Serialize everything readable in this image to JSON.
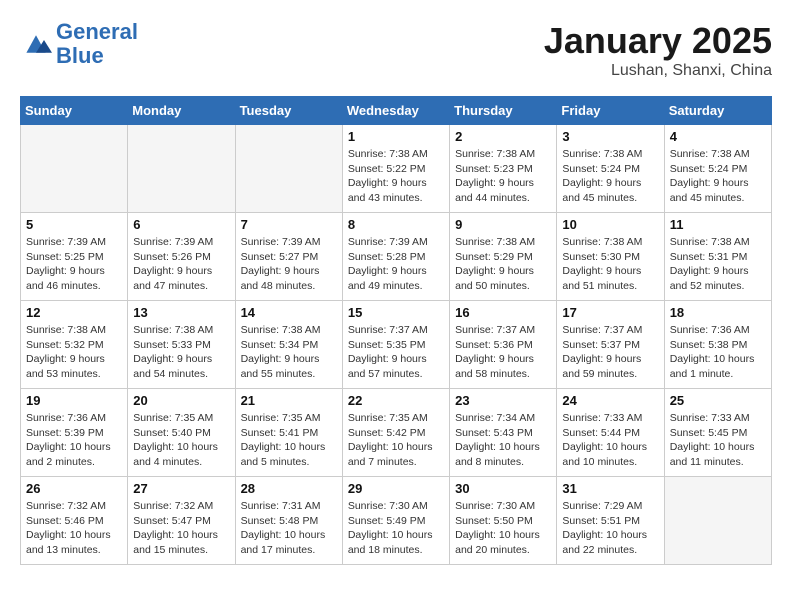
{
  "header": {
    "logo_general": "General",
    "logo_blue": "Blue",
    "month_title": "January 2025",
    "subtitle": "Lushan, Shanxi, China"
  },
  "days_of_week": [
    "Sunday",
    "Monday",
    "Tuesday",
    "Wednesday",
    "Thursday",
    "Friday",
    "Saturday"
  ],
  "weeks": [
    [
      {
        "day": "",
        "info": ""
      },
      {
        "day": "",
        "info": ""
      },
      {
        "day": "",
        "info": ""
      },
      {
        "day": "1",
        "info": "Sunrise: 7:38 AM\nSunset: 5:22 PM\nDaylight: 9 hours\nand 43 minutes."
      },
      {
        "day": "2",
        "info": "Sunrise: 7:38 AM\nSunset: 5:23 PM\nDaylight: 9 hours\nand 44 minutes."
      },
      {
        "day": "3",
        "info": "Sunrise: 7:38 AM\nSunset: 5:24 PM\nDaylight: 9 hours\nand 45 minutes."
      },
      {
        "day": "4",
        "info": "Sunrise: 7:38 AM\nSunset: 5:24 PM\nDaylight: 9 hours\nand 45 minutes."
      }
    ],
    [
      {
        "day": "5",
        "info": "Sunrise: 7:39 AM\nSunset: 5:25 PM\nDaylight: 9 hours\nand 46 minutes."
      },
      {
        "day": "6",
        "info": "Sunrise: 7:39 AM\nSunset: 5:26 PM\nDaylight: 9 hours\nand 47 minutes."
      },
      {
        "day": "7",
        "info": "Sunrise: 7:39 AM\nSunset: 5:27 PM\nDaylight: 9 hours\nand 48 minutes."
      },
      {
        "day": "8",
        "info": "Sunrise: 7:39 AM\nSunset: 5:28 PM\nDaylight: 9 hours\nand 49 minutes."
      },
      {
        "day": "9",
        "info": "Sunrise: 7:38 AM\nSunset: 5:29 PM\nDaylight: 9 hours\nand 50 minutes."
      },
      {
        "day": "10",
        "info": "Sunrise: 7:38 AM\nSunset: 5:30 PM\nDaylight: 9 hours\nand 51 minutes."
      },
      {
        "day": "11",
        "info": "Sunrise: 7:38 AM\nSunset: 5:31 PM\nDaylight: 9 hours\nand 52 minutes."
      }
    ],
    [
      {
        "day": "12",
        "info": "Sunrise: 7:38 AM\nSunset: 5:32 PM\nDaylight: 9 hours\nand 53 minutes."
      },
      {
        "day": "13",
        "info": "Sunrise: 7:38 AM\nSunset: 5:33 PM\nDaylight: 9 hours\nand 54 minutes."
      },
      {
        "day": "14",
        "info": "Sunrise: 7:38 AM\nSunset: 5:34 PM\nDaylight: 9 hours\nand 55 minutes."
      },
      {
        "day": "15",
        "info": "Sunrise: 7:37 AM\nSunset: 5:35 PM\nDaylight: 9 hours\nand 57 minutes."
      },
      {
        "day": "16",
        "info": "Sunrise: 7:37 AM\nSunset: 5:36 PM\nDaylight: 9 hours\nand 58 minutes."
      },
      {
        "day": "17",
        "info": "Sunrise: 7:37 AM\nSunset: 5:37 PM\nDaylight: 9 hours\nand 59 minutes."
      },
      {
        "day": "18",
        "info": "Sunrise: 7:36 AM\nSunset: 5:38 PM\nDaylight: 10 hours\nand 1 minute."
      }
    ],
    [
      {
        "day": "19",
        "info": "Sunrise: 7:36 AM\nSunset: 5:39 PM\nDaylight: 10 hours\nand 2 minutes."
      },
      {
        "day": "20",
        "info": "Sunrise: 7:35 AM\nSunset: 5:40 PM\nDaylight: 10 hours\nand 4 minutes."
      },
      {
        "day": "21",
        "info": "Sunrise: 7:35 AM\nSunset: 5:41 PM\nDaylight: 10 hours\nand 5 minutes."
      },
      {
        "day": "22",
        "info": "Sunrise: 7:35 AM\nSunset: 5:42 PM\nDaylight: 10 hours\nand 7 minutes."
      },
      {
        "day": "23",
        "info": "Sunrise: 7:34 AM\nSunset: 5:43 PM\nDaylight: 10 hours\nand 8 minutes."
      },
      {
        "day": "24",
        "info": "Sunrise: 7:33 AM\nSunset: 5:44 PM\nDaylight: 10 hours\nand 10 minutes."
      },
      {
        "day": "25",
        "info": "Sunrise: 7:33 AM\nSunset: 5:45 PM\nDaylight: 10 hours\nand 11 minutes."
      }
    ],
    [
      {
        "day": "26",
        "info": "Sunrise: 7:32 AM\nSunset: 5:46 PM\nDaylight: 10 hours\nand 13 minutes."
      },
      {
        "day": "27",
        "info": "Sunrise: 7:32 AM\nSunset: 5:47 PM\nDaylight: 10 hours\nand 15 minutes."
      },
      {
        "day": "28",
        "info": "Sunrise: 7:31 AM\nSunset: 5:48 PM\nDaylight: 10 hours\nand 17 minutes."
      },
      {
        "day": "29",
        "info": "Sunrise: 7:30 AM\nSunset: 5:49 PM\nDaylight: 10 hours\nand 18 minutes."
      },
      {
        "day": "30",
        "info": "Sunrise: 7:30 AM\nSunset: 5:50 PM\nDaylight: 10 hours\nand 20 minutes."
      },
      {
        "day": "31",
        "info": "Sunrise: 7:29 AM\nSunset: 5:51 PM\nDaylight: 10 hours\nand 22 minutes."
      },
      {
        "day": "",
        "info": ""
      }
    ]
  ]
}
